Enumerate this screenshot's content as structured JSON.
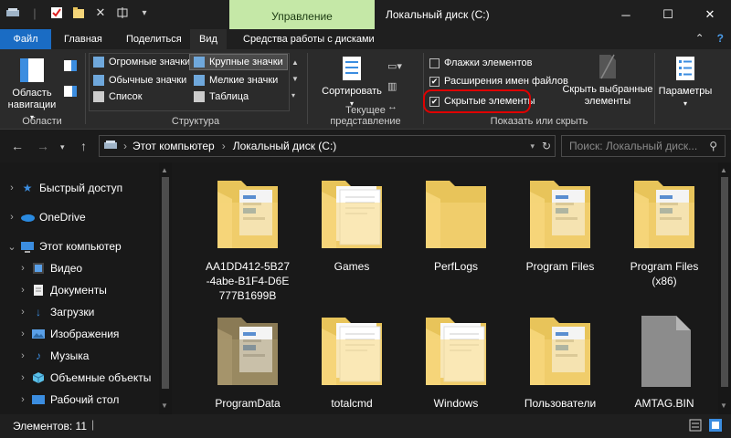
{
  "window": {
    "title": "Локальный диск (C:)",
    "context_tab": "Управление",
    "minimize_icon": "minimize-icon",
    "maximize_icon": "maximize-icon",
    "close_icon": "close-icon"
  },
  "ribbon_tabs": [
    {
      "label": "Файл"
    },
    {
      "label": "Главная"
    },
    {
      "label": "Поделиться"
    },
    {
      "label": "Вид"
    },
    {
      "label": "Средства работы с дисками"
    }
  ],
  "ribbon": {
    "areas": {
      "nav_pane_label": "Область навигации",
      "group": "Области"
    },
    "layout": {
      "items": [
        "Огромные значки",
        "Крупные значки",
        "Обычные значки",
        "Мелкие значки",
        "Список",
        "Таблица"
      ],
      "selected": "Крупные значки",
      "group": "Структура"
    },
    "current_view": {
      "sort_label": "Сортировать",
      "group": "Текущее представление"
    },
    "show_hide": {
      "checkboxes": [
        {
          "label": "Флажки элементов",
          "checked": false
        },
        {
          "label": "Расширения имен файлов",
          "checked": true
        },
        {
          "label": "Скрытые элементы",
          "checked": true
        }
      ],
      "hide_selected_label": "Скрыть выбранные элементы",
      "group": "Показать или скрыть"
    },
    "options_label": "Параметры"
  },
  "address": {
    "crumbs": [
      "Этот компьютер",
      "Локальный диск (C:)"
    ],
    "search_placeholder": "Поиск: Локальный диск..."
  },
  "nav_pane": [
    {
      "label": "Быстрый доступ",
      "icon": "star-icon",
      "level": 0,
      "expanded": false
    },
    {
      "label": "OneDrive",
      "icon": "cloud-icon",
      "level": 0,
      "expanded": false
    },
    {
      "label": "Этот компьютер",
      "icon": "computer-icon",
      "level": 0,
      "expanded": true
    },
    {
      "label": "Видео",
      "icon": "video-icon",
      "level": 1,
      "expanded": false
    },
    {
      "label": "Документы",
      "icon": "document-icon",
      "level": 1,
      "expanded": false
    },
    {
      "label": "Загрузки",
      "icon": "download-icon",
      "level": 1,
      "expanded": false
    },
    {
      "label": "Изображения",
      "icon": "image-icon",
      "level": 1,
      "expanded": false
    },
    {
      "label": "Музыка",
      "icon": "music-icon",
      "level": 1,
      "expanded": false
    },
    {
      "label": "Объемные объекты",
      "icon": "cube-icon",
      "level": 1,
      "expanded": false
    },
    {
      "label": "Рабочий стол",
      "icon": "desktop-icon",
      "level": 1,
      "expanded": false
    }
  ],
  "files": [
    {
      "name": "AA1DD412-5B27\n-4abe-B1F4-D6E\n777B1699B",
      "kind": "folder-docs"
    },
    {
      "name": "Games",
      "kind": "folder-white"
    },
    {
      "name": "PerfLogs",
      "kind": "folder-empty"
    },
    {
      "name": "Program Files",
      "kind": "folder-docs"
    },
    {
      "name": "Program Files\n(x86)",
      "kind": "folder-docs"
    },
    {
      "name": "ProgramData",
      "kind": "folder-hidden"
    },
    {
      "name": "totalcmd",
      "kind": "folder-white"
    },
    {
      "name": "Windows",
      "kind": "folder-white"
    },
    {
      "name": "Пользователи",
      "kind": "folder-docs"
    },
    {
      "name": "AMTAG.BIN",
      "kind": "file"
    }
  ],
  "status": {
    "count_text": "Элементов: 11"
  },
  "colors": {
    "accent": "#1a6cc4",
    "context": "#c5e8a7",
    "highlight": "#e00000",
    "folder": "#f5d67a"
  }
}
